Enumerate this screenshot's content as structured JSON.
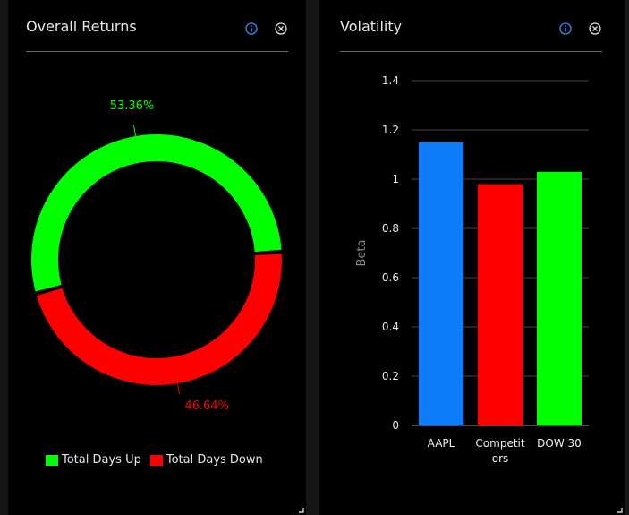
{
  "panels": {
    "left": {
      "title": "Overall Returns"
    },
    "right": {
      "title": "Volatility"
    }
  },
  "icons": {
    "info": "info-circle-icon",
    "close": "close-circle-icon",
    "resize": "resize-grip-icon"
  },
  "colors": {
    "up": "#00ff00",
    "down": "#ff0000",
    "aapl": "#0f7cfa",
    "competitors": "#ff0000",
    "dow": "#00ff00",
    "info": "#2d8ef0"
  },
  "chart_data": [
    {
      "type": "pie",
      "style": "donut",
      "title": "Overall Returns",
      "slices": [
        {
          "label": "Total Days Up",
          "value": 53.36,
          "display": "53.36%"
        },
        {
          "label": "Total Days Down",
          "value": 46.64,
          "display": "46.64%"
        }
      ],
      "legend": [
        "Total Days Up",
        "Total Days Down"
      ],
      "legend_position": "bottom"
    },
    {
      "type": "bar",
      "title": "Volatility",
      "categories": [
        "AAPL",
        "Competitors",
        "DOW 30"
      ],
      "category_lines": [
        [
          "AAPL"
        ],
        [
          "Competit",
          "ors"
        ],
        [
          "DOW 30"
        ]
      ],
      "values": [
        1.15,
        0.98,
        1.03
      ],
      "ylabel": "Beta",
      "xlabel": "",
      "ylim": [
        0,
        1.4
      ],
      "yticks": [
        "0",
        "0.2",
        "0.4",
        "0.6",
        "0.8",
        "1",
        "1.2",
        "1.4"
      ],
      "grid": true
    }
  ]
}
